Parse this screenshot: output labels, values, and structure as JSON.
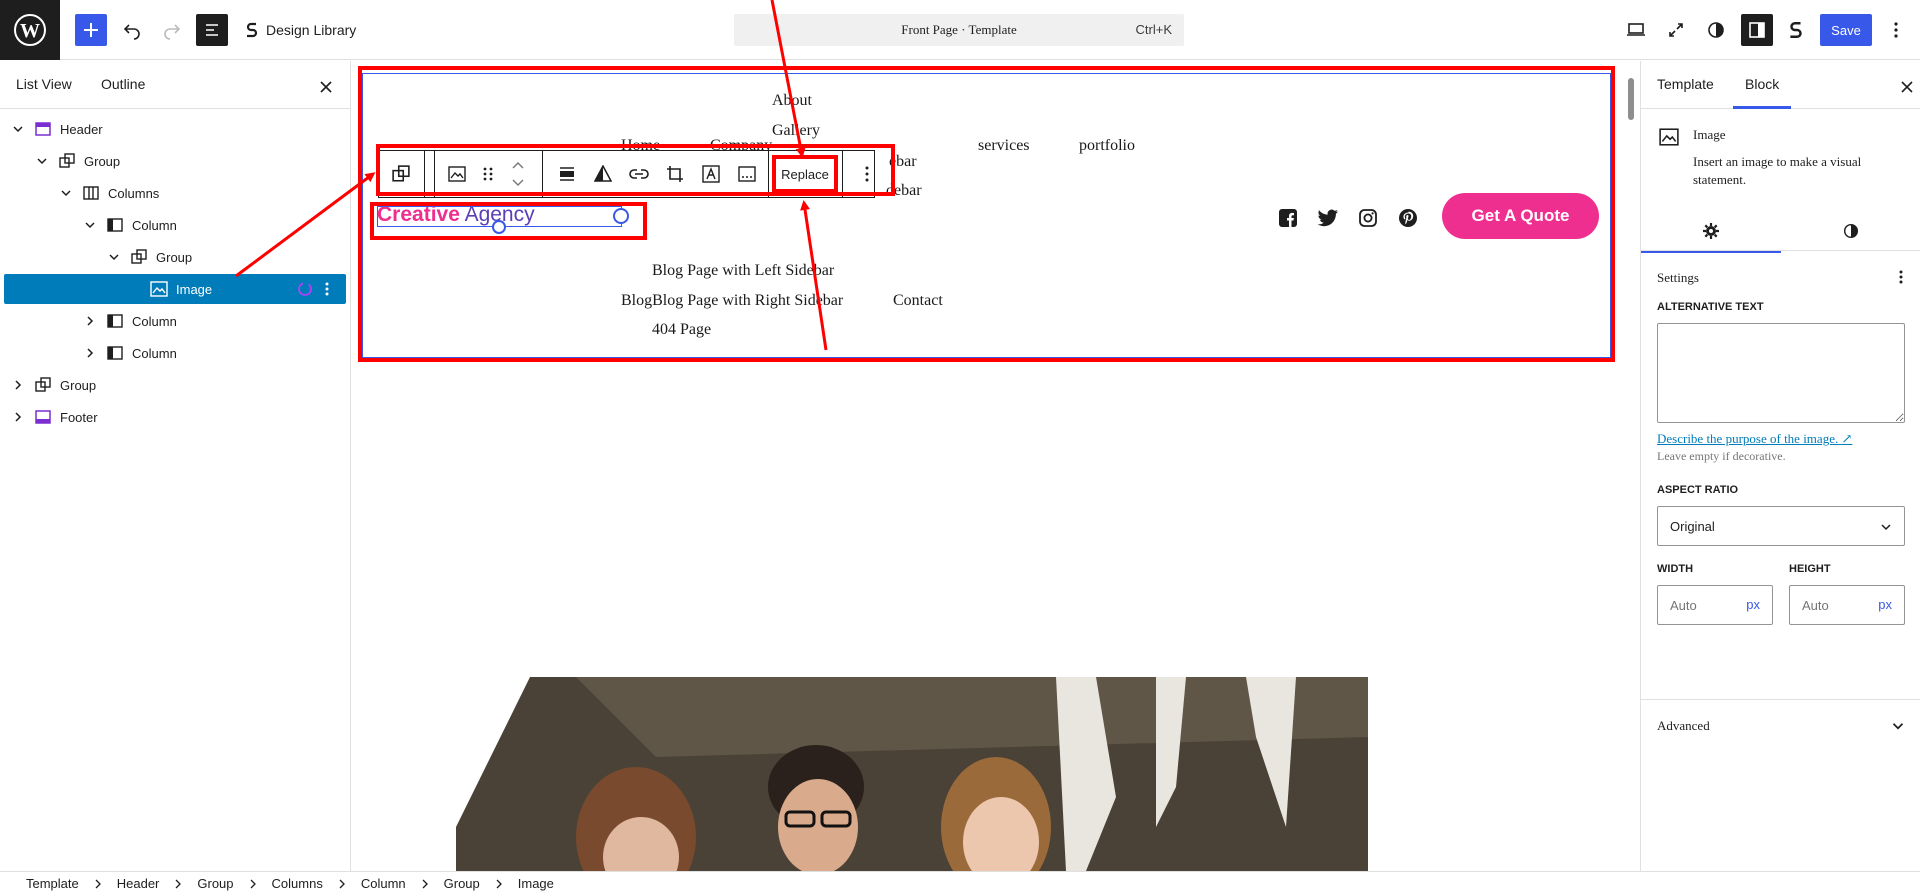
{
  "topbar": {
    "design_library_label": "Design Library",
    "command_title": "Front Page · Template",
    "command_shortcut": "Ctrl+K",
    "save_label": "Save"
  },
  "left_panel": {
    "tabs": [
      "List View",
      "Outline"
    ],
    "tree": [
      {
        "label": "Header"
      },
      {
        "label": "Group"
      },
      {
        "label": "Columns"
      },
      {
        "label": "Column"
      },
      {
        "label": "Group"
      },
      {
        "label": "Image"
      },
      {
        "label": "Column"
      },
      {
        "label": "Column"
      },
      {
        "label": "Group"
      },
      {
        "label": "Footer"
      }
    ]
  },
  "canvas": {
    "nav": {
      "about": "About",
      "gallery": "Gallery",
      "home": "Home",
      "company": "Company",
      "sidebar_frag1": "ebar",
      "sidebar_frag2": "debar",
      "services": "services",
      "portfolio": "portfolio",
      "blog_left": "Blog Page with Left Sidebar",
      "blog_right": "BlogBlog Page with Right Sidebar",
      "contact": "Contact",
      "page_404": "404 Page"
    },
    "logo": {
      "part1": "Creative",
      "part2": " Agency"
    },
    "quote_button": "Get A Quote",
    "replace_label": "Replace",
    "social_icons": [
      "facebook-icon",
      "twitter-icon",
      "instagram-icon",
      "pinterest-icon"
    ],
    "accent_pink": "#ee2f8f",
    "accent_purple": "#5b3fb5"
  },
  "right_panel": {
    "tabs": [
      "Template",
      "Block"
    ],
    "block_title": "Image",
    "block_desc": "Insert an image to make a visual statement.",
    "settings_label": "Settings",
    "alt_text_label": "ALTERNATIVE TEXT",
    "alt_text_value": "",
    "help_link": "Describe the purpose of the image.",
    "help_link_arrow": "↗",
    "help_text": "Leave empty if decorative.",
    "aspect_ratio_label": "ASPECT RATIO",
    "aspect_ratio_value": "Original",
    "width_label": "WIDTH",
    "height_label": "HEIGHT",
    "width_placeholder": "Auto",
    "height_placeholder": "Auto",
    "unit": "px",
    "advanced_label": "Advanced"
  },
  "breadcrumb": [
    "Template",
    "Header",
    "Group",
    "Columns",
    "Column",
    "Group",
    "Image"
  ]
}
